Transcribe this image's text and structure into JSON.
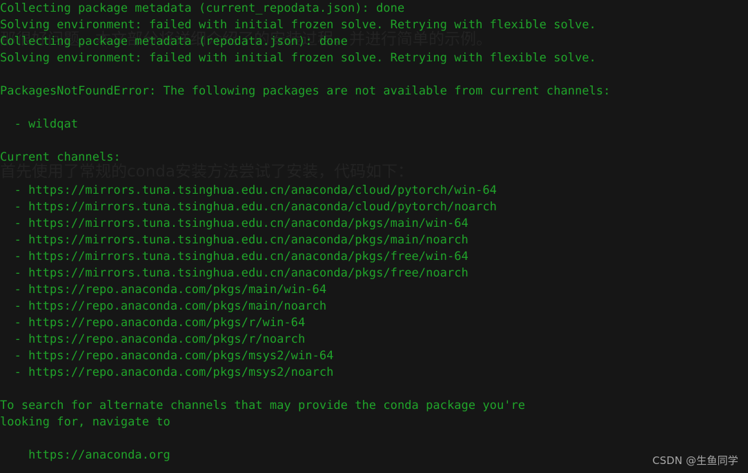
{
  "terminal": {
    "background_color": "#161616",
    "text_color": "#20A52A",
    "lines": [
      "Collecting package metadata (current_repodata.json): done",
      "Solving environment: failed with initial frozen solve. Retrying with flexible solve.",
      "Collecting package metadata (repodata.json): done",
      "Solving environment: failed with initial frozen solve. Retrying with flexible solve.",
      "",
      "PackagesNotFoundError: The following packages are not available from current channels:",
      "",
      "  - wildqat",
      "",
      "Current channels:",
      "",
      "  - https://mirrors.tuna.tsinghua.edu.cn/anaconda/cloud/pytorch/win-64",
      "  - https://mirrors.tuna.tsinghua.edu.cn/anaconda/cloud/pytorch/noarch",
      "  - https://mirrors.tuna.tsinghua.edu.cn/anaconda/pkgs/main/win-64",
      "  - https://mirrors.tuna.tsinghua.edu.cn/anaconda/pkgs/main/noarch",
      "  - https://mirrors.tuna.tsinghua.edu.cn/anaconda/pkgs/free/win-64",
      "  - https://mirrors.tuna.tsinghua.edu.cn/anaconda/pkgs/free/noarch",
      "  - https://repo.anaconda.com/pkgs/main/win-64",
      "  - https://repo.anaconda.com/pkgs/main/noarch",
      "  - https://repo.anaconda.com/pkgs/r/win-64",
      "  - https://repo.anaconda.com/pkgs/r/noarch",
      "  - https://repo.anaconda.com/pkgs/msys2/win-64",
      "  - https://repo.anaconda.com/pkgs/msys2/noarch",
      "",
      "To search for alternate channels that may provide the conda package you're",
      "looking for, navigate to",
      "",
      "    https://anaconda.org"
    ]
  },
  "background_watermark": {
    "color": "#232323",
    "line_1": "那很好问题，本文部分将详细介绍了的安装过程，并进行简单的示例。",
    "line_2": "首先使用了常规的conda安装方法尝试了安装，代码如下："
  },
  "corner_watermark": {
    "text": "CSDN @生鱼同学",
    "color": "#a8a8a8"
  }
}
